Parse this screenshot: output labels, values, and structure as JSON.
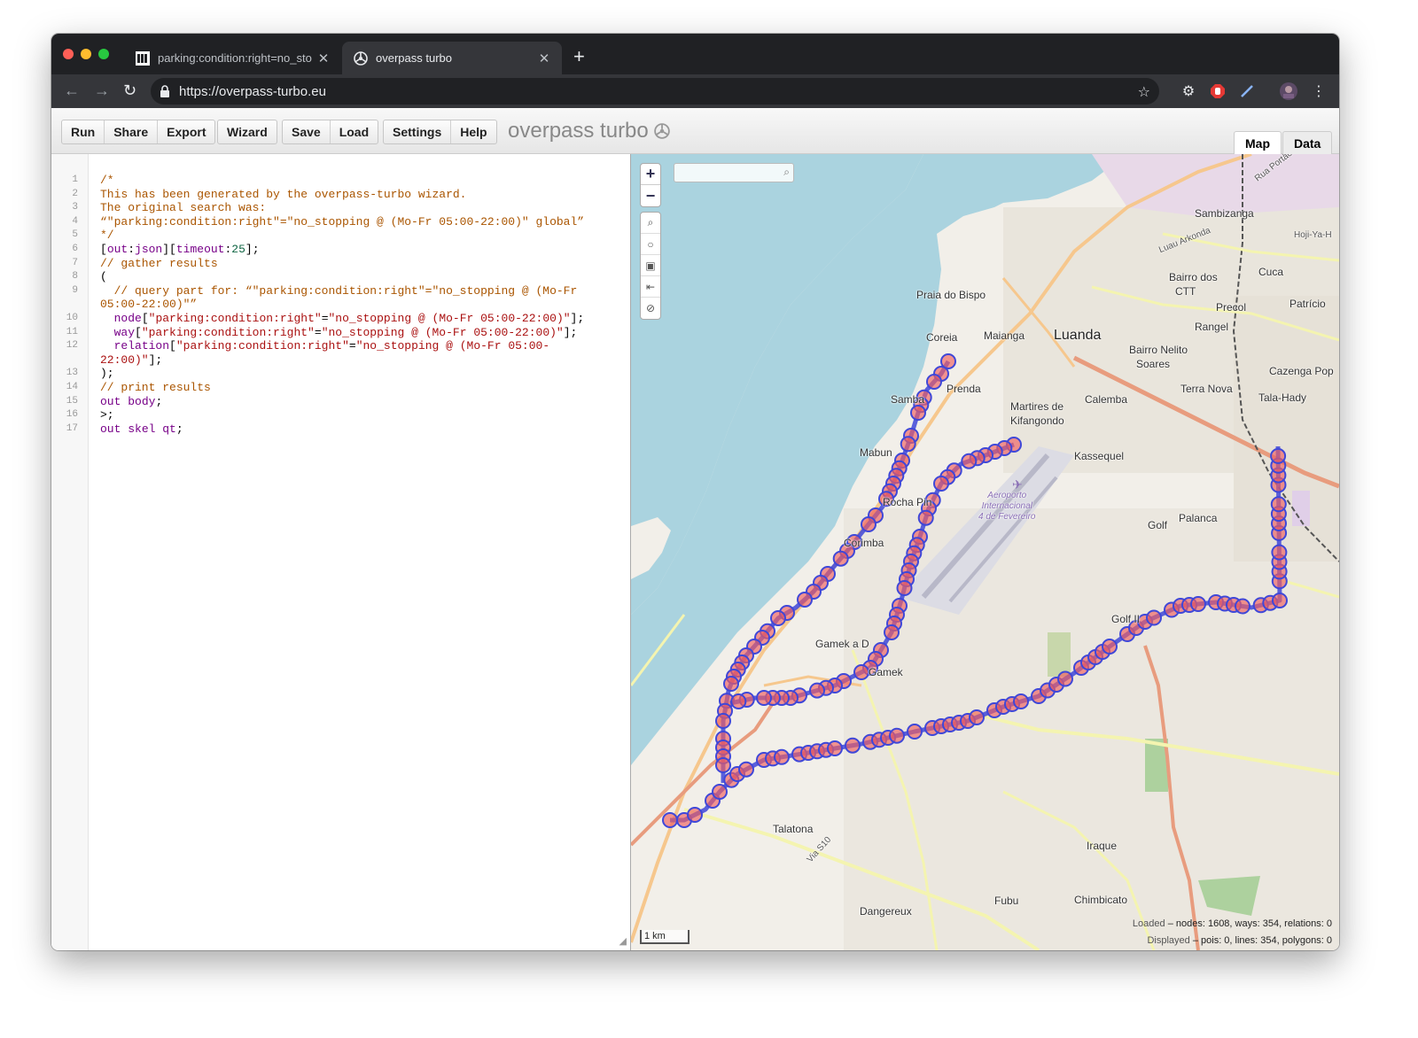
{
  "browser": {
    "tabs": [
      {
        "title": "parking:condition:right=no_sto",
        "active": false,
        "favicon": "openstreetmap-wiki-icon"
      },
      {
        "title": "overpass turbo",
        "active": true,
        "favicon": "overpass-turbo-icon"
      }
    ],
    "url": "https://overpass-turbo.eu",
    "colors": {
      "close": "#ff5f57",
      "minimize": "#febc2e",
      "maximize": "#28c840",
      "frame": "#202124",
      "toolbar": "#35363a"
    }
  },
  "toolbar": {
    "groups": [
      [
        "Run",
        "Share",
        "Export"
      ],
      [
        "Wizard"
      ],
      [
        "Save",
        "Load"
      ],
      [
        "Settings",
        "Help"
      ]
    ],
    "brand": "overpass turbo",
    "view_tabs": [
      "Map",
      "Data"
    ],
    "active_view": "Map"
  },
  "editor": {
    "lines": [
      {
        "n": "1",
        "tokens": [
          [
            "/*",
            "comment"
          ]
        ]
      },
      {
        "n": "2",
        "tokens": [
          [
            "This has been generated by the overpass-turbo wizard.",
            "comment"
          ]
        ]
      },
      {
        "n": "3",
        "tokens": [
          [
            "The original search was:",
            "comment"
          ]
        ]
      },
      {
        "n": "4",
        "tokens": [
          [
            "“\"parking:condition:right\"=\"no_stopping @ (Mo-Fr 05:00-22:00)\" global”",
            "comment"
          ]
        ]
      },
      {
        "n": "5",
        "tokens": [
          [
            "*/",
            "comment"
          ]
        ]
      },
      {
        "n": "6",
        "tokens": [
          [
            "[",
            "plain"
          ],
          [
            "out",
            "kw"
          ],
          [
            ":",
            "plain"
          ],
          [
            "json",
            "kw"
          ],
          [
            "][",
            "plain"
          ],
          [
            "timeout",
            "kw"
          ],
          [
            ":",
            "plain"
          ],
          [
            "25",
            "num"
          ],
          [
            "];",
            "plain"
          ]
        ]
      },
      {
        "n": "7",
        "tokens": [
          [
            "// gather results",
            "comment"
          ]
        ]
      },
      {
        "n": "8",
        "tokens": [
          [
            "(",
            "plain"
          ]
        ]
      },
      {
        "n": "9",
        "tokens": [
          [
            "  // query part for: “\"parking:condition:right\"=\"no_stopping @ (Mo-Fr",
            "comment"
          ]
        ]
      },
      {
        "n": "",
        "tokens": [
          [
            "05:00-22:00)\"”",
            "comment"
          ]
        ]
      },
      {
        "n": "10",
        "tokens": [
          [
            "  ",
            "plain"
          ],
          [
            "node",
            "kw"
          ],
          [
            "[",
            "plain"
          ],
          [
            "\"parking:condition:right\"",
            "str"
          ],
          [
            "=",
            "plain"
          ],
          [
            "\"no_stopping @ (Mo-Fr 05:00-22:00)\"",
            "str"
          ],
          [
            "];",
            "plain"
          ]
        ]
      },
      {
        "n": "11",
        "tokens": [
          [
            "  ",
            "plain"
          ],
          [
            "way",
            "kw"
          ],
          [
            "[",
            "plain"
          ],
          [
            "\"parking:condition:right\"",
            "str"
          ],
          [
            "=",
            "plain"
          ],
          [
            "\"no_stopping @ (Mo-Fr 05:00-22:00)\"",
            "str"
          ],
          [
            "];",
            "plain"
          ]
        ]
      },
      {
        "n": "12",
        "tokens": [
          [
            "  ",
            "plain"
          ],
          [
            "relation",
            "kw"
          ],
          [
            "[",
            "plain"
          ],
          [
            "\"parking:condition:right\"",
            "str"
          ],
          [
            "=",
            "plain"
          ],
          [
            "\"no_stopping @ (Mo-Fr 05:00-",
            "str"
          ]
        ]
      },
      {
        "n": "",
        "tokens": [
          [
            "22:00)\"",
            "str"
          ],
          [
            "];",
            "plain"
          ]
        ]
      },
      {
        "n": "13",
        "tokens": [
          [
            ");",
            "plain"
          ]
        ]
      },
      {
        "n": "14",
        "tokens": [
          [
            "// print results",
            "comment"
          ]
        ]
      },
      {
        "n": "15",
        "tokens": [
          [
            "out ",
            "kw"
          ],
          [
            "body",
            "kw"
          ],
          [
            ";",
            "plain"
          ]
        ]
      },
      {
        "n": "16",
        "tokens": [
          [
            ">;",
            "plain"
          ]
        ]
      },
      {
        "n": "17",
        "tokens": [
          [
            "out ",
            "kw"
          ],
          [
            "skel ",
            "kw"
          ],
          [
            "qt",
            "kw"
          ],
          [
            ";",
            "plain"
          ]
        ]
      }
    ]
  },
  "map": {
    "places": [
      {
        "name": "Sambizanga",
        "kind": "normal"
      },
      {
        "name": "Hoji-Ya-H",
        "kind": "small"
      },
      {
        "name": "Cuca",
        "kind": "normal"
      },
      {
        "name": "Bairro dos",
        "kind": "normal"
      },
      {
        "name": "CTT",
        "kind": "normal"
      },
      {
        "name": "Patrício",
        "kind": "normal"
      },
      {
        "name": "Praia do Bispo",
        "kind": "normal"
      },
      {
        "name": "Precol",
        "kind": "normal"
      },
      {
        "name": "Rangel",
        "kind": "normal"
      },
      {
        "name": "Coreia",
        "kind": "normal"
      },
      {
        "name": "Maianga",
        "kind": "normal"
      },
      {
        "name": "Luanda",
        "kind": "city"
      },
      {
        "name": "Bairro Nelito",
        "kind": "normal"
      },
      {
        "name": "Soares",
        "kind": "normal"
      },
      {
        "name": "Cazenga Pop",
        "kind": "normal"
      },
      {
        "name": "Prenda",
        "kind": "normal"
      },
      {
        "name": "Terra Nova",
        "kind": "normal"
      },
      {
        "name": "Tala-Hady",
        "kind": "normal"
      },
      {
        "name": "Samba",
        "kind": "normal"
      },
      {
        "name": "Martires de",
        "kind": "normal"
      },
      {
        "name": "Kifangondo",
        "kind": "normal"
      },
      {
        "name": "Calemba",
        "kind": "normal"
      },
      {
        "name": "Mabun",
        "kind": "normal"
      },
      {
        "name": "Kassequel",
        "kind": "normal"
      },
      {
        "name": "Rocha Pin",
        "kind": "normal"
      },
      {
        "name": "Golf",
        "kind": "normal"
      },
      {
        "name": "Palanca",
        "kind": "normal"
      },
      {
        "name": "Corimba",
        "kind": "normal"
      },
      {
        "name": "Golf II",
        "kind": "normal"
      },
      {
        "name": "Gamek a D",
        "kind": "normal"
      },
      {
        "name": "Gamek",
        "kind": "normal"
      },
      {
        "name": "Talatona",
        "kind": "normal"
      },
      {
        "name": "Iraque",
        "kind": "normal"
      },
      {
        "name": "Fubu",
        "kind": "normal"
      },
      {
        "name": "Chimbicato",
        "kind": "normal"
      },
      {
        "name": "Dangereux",
        "kind": "normal"
      },
      {
        "name": "Luau Arkonda",
        "kind": "small"
      },
      {
        "name": "Rua Portão",
        "kind": "small"
      },
      {
        "name": "Via S10",
        "kind": "small"
      }
    ],
    "airport_label": [
      "Aeroporto",
      "Internacional",
      "4 de Fevereiro"
    ],
    "scale": "1 km",
    "stats": {
      "loaded_label": "Loaded",
      "loaded_value": "nodes: 1608, ways: 354, relations: 0",
      "displayed_label": "Displayed",
      "displayed_value": "pois: 0, lines: 354, polygons: 0"
    },
    "colors": {
      "water": "#aad3df",
      "land": "#f2efe9",
      "route": "#3f47d8",
      "marker_fill": "#f06060",
      "trunk": "#e89c7e",
      "primary": "#f6c78d",
      "secondary": "#f4f4b0"
    }
  }
}
